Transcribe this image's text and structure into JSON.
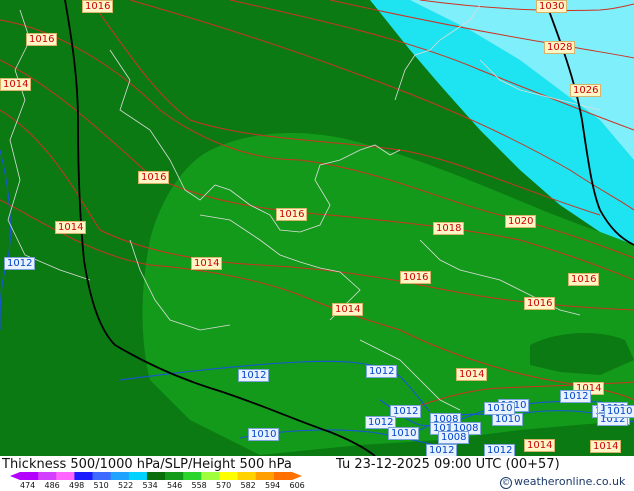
{
  "map": {
    "colors": {
      "dark_green": "#0b7a13",
      "mid_green": "#139a1a",
      "bright_green": "#2bb82b",
      "light_cyan": "#52f0f5",
      "cyan": "#1ee3f0",
      "light_blue": "#a8f4ff",
      "isobar": "#cc3322",
      "height_contour": "#1a55d6",
      "border": "#000000",
      "coast": "#dddddd"
    },
    "labels": [
      {
        "text": "1016",
        "style": "red"
      },
      {
        "text": "1016",
        "style": "red"
      },
      {
        "text": "1014",
        "style": "red"
      },
      {
        "text": "1030",
        "style": "red"
      },
      {
        "text": "1028",
        "style": "red"
      },
      {
        "text": "1026",
        "style": "red"
      },
      {
        "text": "1016",
        "style": "red"
      },
      {
        "text": "1014",
        "style": "red"
      },
      {
        "text": "1012",
        "style": "blue"
      },
      {
        "text": "1016",
        "style": "red"
      },
      {
        "text": "1018",
        "style": "red"
      },
      {
        "text": "1020",
        "style": "red"
      },
      {
        "text": "1014",
        "style": "red"
      },
      {
        "text": "1016",
        "style": "red"
      },
      {
        "text": "1016",
        "style": "red"
      },
      {
        "text": "1016",
        "style": "red"
      },
      {
        "text": "1014",
        "style": "red"
      },
      {
        "text": "1012",
        "style": "blue"
      },
      {
        "text": "1012",
        "style": "blue"
      },
      {
        "text": "1014",
        "style": "red"
      },
      {
        "text": "1014",
        "style": "red"
      },
      {
        "text": "1012",
        "style": "blue"
      },
      {
        "text": "1012",
        "style": "blue"
      },
      {
        "text": "1010",
        "style": "blue"
      },
      {
        "text": "1010",
        "style": "blue"
      },
      {
        "text": "1012",
        "style": "blue"
      },
      {
        "text": "1008",
        "style": "blue"
      },
      {
        "text": "1010",
        "style": "blue"
      },
      {
        "text": "1012",
        "style": "blue"
      },
      {
        "text": "1008",
        "style": "blue"
      },
      {
        "text": "1010",
        "style": "blue"
      },
      {
        "text": "1010",
        "style": "blue"
      },
      {
        "text": "1008",
        "style": "blue"
      },
      {
        "text": "1010",
        "style": "blue"
      },
      {
        "text": "1012",
        "style": "blue"
      },
      {
        "text": "1012",
        "style": "blue"
      },
      {
        "text": "1012",
        "style": "blue"
      },
      {
        "text": "1014",
        "style": "red"
      },
      {
        "text": "1014",
        "style": "red"
      },
      {
        "text": "1010",
        "style": "blue"
      },
      {
        "text": "1012",
        "style": "blue"
      },
      {
        "text": "1010",
        "style": "blue"
      }
    ]
  },
  "footer": {
    "title": "Thickness 500/1000 hPa/SLP/Height 500 hPa",
    "valid": "Tu 23-12-2025 09:00 UTC (00+57)",
    "credit": "© weatheronline.co.uk",
    "legend_ticks": [
      "474",
      "486",
      "498",
      "510",
      "522",
      "534",
      "546",
      "558",
      "570",
      "582",
      "594",
      "606"
    ],
    "legend_colors": [
      "#b400ff",
      "#d43fff",
      "#ff66ff",
      "#1a1aff",
      "#3d6bff",
      "#1fa3ff",
      "#00d2ff",
      "#0a6e0a",
      "#139a1a",
      "#2bd52b",
      "#a0ff3c",
      "#ffff00",
      "#ffd200",
      "#ffa000",
      "#ff7000"
    ]
  }
}
